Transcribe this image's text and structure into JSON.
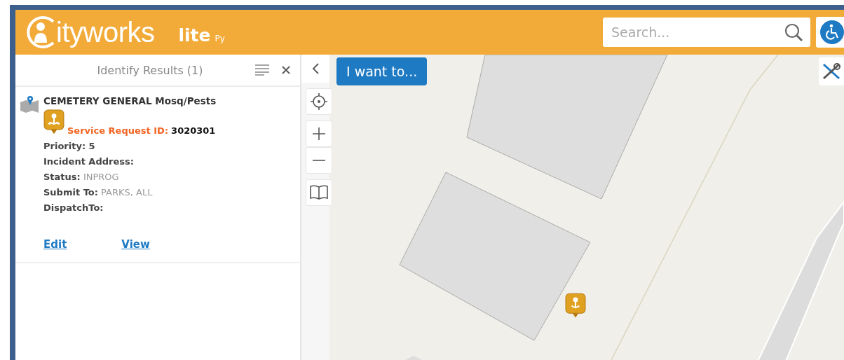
{
  "header": {
    "logo_text": "ityworks",
    "edition": "lite",
    "edition_suffix": "Py",
    "search": {
      "placeholder": "Search..."
    }
  },
  "panel": {
    "title": "Identify Results (1)",
    "result": {
      "title": "CEMETERY GENERAL Mosq/Pests",
      "id_label": "Service Request ID:",
      "id_value": "3020301",
      "fields": [
        {
          "label": "Priority:",
          "value": "5",
          "kind": "bold"
        },
        {
          "label": "Incident Address:"
        },
        {
          "label": "Status:",
          "value": "INPROG",
          "kind": "muted"
        },
        {
          "label": "Submit To:",
          "value": "PARKS, ALL",
          "kind": "muted"
        },
        {
          "label": "DispatchTo:"
        }
      ],
      "links": [
        "Edit",
        "View"
      ]
    }
  },
  "map": {
    "kind": "picture",
    "action_button": "I want to..."
  }
}
